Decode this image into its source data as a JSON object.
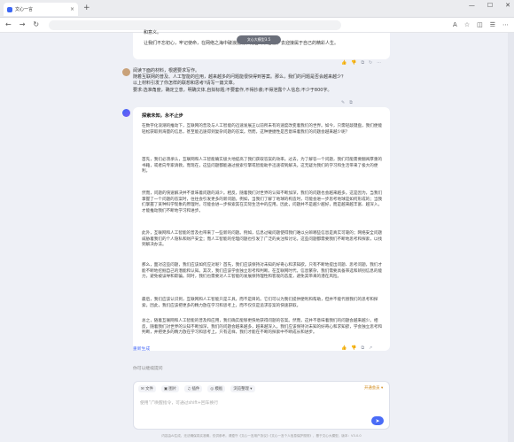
{
  "browser": {
    "tab_title": "文心一言",
    "new_tab": "+",
    "tab_close": "×"
  },
  "window_controls": [
    "—",
    "☐",
    "✕"
  ],
  "scroll_pill": "文心大模型3.5",
  "previous_answer": {
    "line1": "和意义。",
    "line2": "让我们不忘初心，牢记使命，在网络之海中破浪前行，用奋斗和智慧，去迎接属于自己的精彩人生。",
    "actions": [
      "👍",
      "👎",
      "⧉",
      "↻",
      "⋯"
    ]
  },
  "question": "阅读下面的材料，根据要求写作。\n随着互联网的普及、人工智能的应用，越来越多的问题能很快得到答案。那么，我们的问题是否会越来越少？\n以上材料引发了你怎样的联想和思考?请写一篇文章。\n要求:选准角度，确定立意，明确文体,自拟标题;不要套作,不得抄袭;不得泄露个人信息;不少于800字。",
  "answer": {
    "title": "探索未知，永不止步",
    "paragraphs": [
      "在数字化浪潮的推动下，互联网的普及与人工智能的迅速发展正以前所未有的速度改变着我们的世界。如今，只需轻敲键盘，我们便能轻松获取到海量的信息，甚至能迅速得到复杂问题的答案。然而，这种便捷性是否意味着我们的问题会越来越少呢？",
      "首先，我们必须承认，互联网和人工智能确实极大地提高了我们获取答案的效率。过去，为了解答一个问题，我们可能需要翻阅厚重的书籍，或者向专家请教。而现在，这些问题都能通过搜索引擎或智能助手迅速得到解决。这无疑为我们的学习和生活带来了极大的便利。",
      "然而，问题的快速解决并不意味着问题的减少。相反，随着我们对世界的认知不断加深，我们的问题也会越来越多。这是因为，当我们掌握了一个问题的答案时，往往会引发更多的新问题。例如，当我们了解了地球的构造时，可能会进一步思考地球是如何形成的；当我们掌握了某种科学现象的原理时，可能会进一步探索其在实际生活中的应用。因此，问题并不是越少越好，而是越来越丰富、越深入，才能推动我们不断地学习和进步。",
      "此外，互联网和人工智能的普及也带来了一些新的问题。例如，信息过载问题使得我们难以分辨哪些信息是真实可靠的；网络安全问题威胁着我们的个人隐私和财产安全；而人工智能的伦理问题也引发了广泛的关注和讨论。这些问题都需要我们不断地思考和探索，以找到解决办法。",
      "那么，面对这些问题，我们应该如何应对呢？首先，我们应该保持对未知的好奇心和求知欲。只有不断地提出问题、思考问题，我们才能不断地挖掘自己的潜能和认知。其次，我们应该学会独立思考和判断。在互联网时代，信息繁杂，我们需要具备筛选和辨别信息的能力，避免被误导和欺骗。同时，我们也需要对人工智能的发展保持理性和客观的态度，避免其带来的潜在风险。",
      "最后，我们应该认识到，互联网和人工智能只是工具，而不是目的。它们可以为我们提供便利和帮助，但并不能代替我们的思考和探索。因此，我们应该把更多的精力放在学习和思考上，而不仅仅是追求答案的快速获取。",
      "总之，随着互联网和人工智能的普及和应用，我们确实能够更快地获得问题的答案。然而，这并不意味着我们的问题会越来越少。相反，随着我们对世界的认知不断加深，我们的问题会越来越多，越来越深入。我们应该保持对未知的好奇心和求知欲，学会独立思考和判断，并把更多的精力放在学习和思考上。只有这样，我们才能在不断的探索中不断成长和进步。"
    ],
    "regenerate": "重新生成"
  },
  "input": {
    "hint": "你可以继续提问",
    "tools": [
      "✉ 文件",
      "▣ 图片",
      "♫ 插件",
      "◎ 模板",
      "浏览整理 ▾"
    ],
    "mode": "开通会员 ▾",
    "placeholder": "使用“/”唤醒指令，可通过shift+回车换行",
    "send": "➤"
  },
  "footer": "内容由AI生成，无法确保真实准确，仅供参考。请遵守《文心一言用户协议》《文心一言个人信息保护规则》，基于文心大模型，版本：V3.0.0"
}
